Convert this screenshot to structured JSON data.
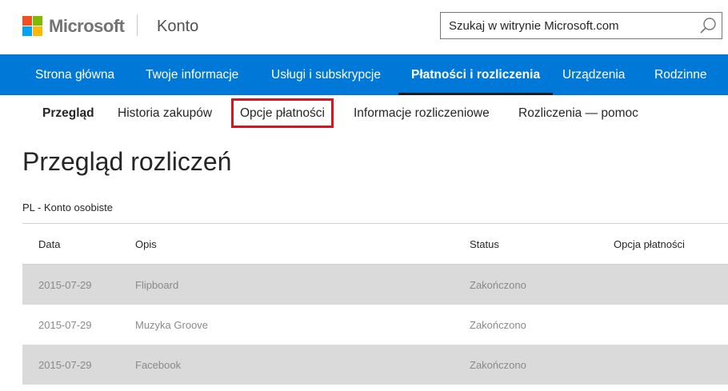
{
  "header": {
    "brand": "Microsoft",
    "section": "Konto",
    "search_placeholder": "Szukaj w witrynie Microsoft.com",
    "search_icon": "search-icon"
  },
  "nav": {
    "items": [
      {
        "label": "Strona główna",
        "active": false
      },
      {
        "label": "Twoje informacje",
        "active": false
      },
      {
        "label": "Usługi i subskrypcje",
        "active": false
      },
      {
        "label": "Płatności i rozliczenia",
        "active": true
      },
      {
        "label": "Urządzenia",
        "active": false
      },
      {
        "label": "Rodzinne",
        "active": false
      }
    ]
  },
  "subnav": {
    "items": [
      {
        "label": "Przegląd",
        "active": true
      },
      {
        "label": "Historia zakupów",
        "active": false
      },
      {
        "label": "Opcje płatności",
        "active": false,
        "highlighted": true
      },
      {
        "label": "Informacje rozliczeniowe",
        "active": false
      },
      {
        "label": "Rozliczenia — pomoc",
        "active": false
      }
    ]
  },
  "page": {
    "title": "Przegląd rozliczeń",
    "account": "PL - Konto osobiste"
  },
  "table": {
    "columns": [
      "Data",
      "Opis",
      "Status",
      "Opcja płatności"
    ],
    "rows": [
      {
        "date": "2015-07-29",
        "description": "Flipboard",
        "status": "Zakończono",
        "payment": ""
      },
      {
        "date": "2015-07-29",
        "description": "Muzyka Groove",
        "status": "Zakończono",
        "payment": ""
      },
      {
        "date": "2015-07-29",
        "description": "Facebook",
        "status": "Zakończono",
        "payment": ""
      }
    ]
  },
  "colors": {
    "nav_blue": "#0078d7",
    "highlight_red": "#d9141d",
    "row_shade": "#dadada"
  }
}
